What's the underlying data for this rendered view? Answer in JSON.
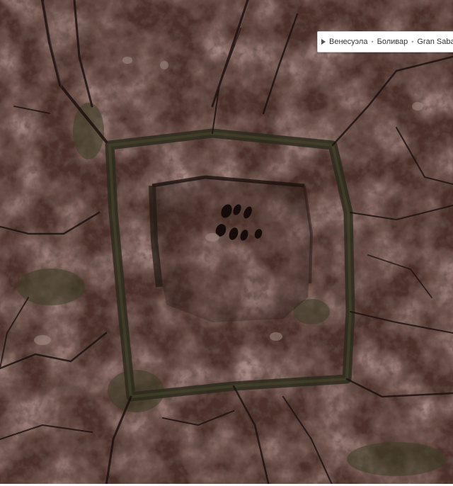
{
  "breadcrumb": {
    "items": [
      "Венесуэла",
      "Боливар",
      "Gran Saban"
    ],
    "separator": "•"
  },
  "icons": {
    "expand": "triangle-right-icon"
  },
  "colors": {
    "terrain_base": "#4a3029",
    "terrain_dark": "#2a1a17",
    "terrain_light": "#7a6058",
    "vegetation": "#3a3a25",
    "panel_bg": "#ffffff",
    "panel_border": "#cfcfcf",
    "text": "#333333"
  }
}
